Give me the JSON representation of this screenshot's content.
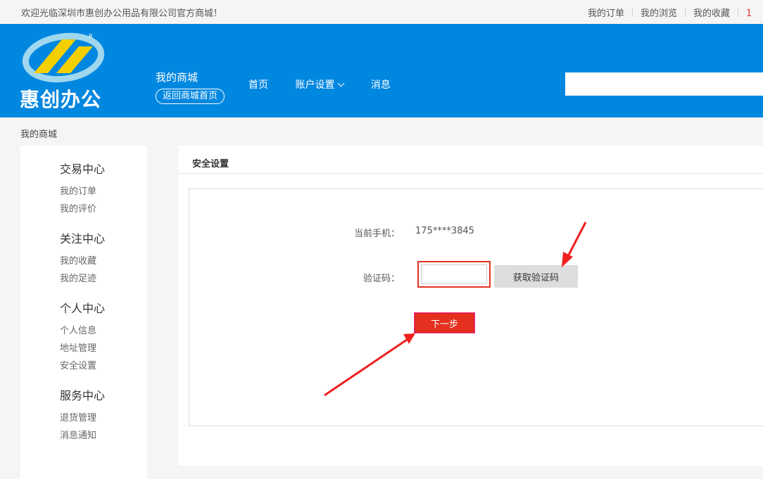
{
  "topbar": {
    "welcome": "欢迎光临深圳市惠创办公用品有限公司官方商城！",
    "links": [
      "我的订单",
      "我的浏览",
      "我的收藏"
    ],
    "cut_text": "1"
  },
  "header": {
    "logo_text": "惠创办公",
    "logo_mark": "R",
    "my_mall": "我的商城",
    "back_button": "返回商城首页",
    "nav": {
      "home": "首页",
      "account": "账户设置",
      "messages": "消息"
    },
    "search_placeholder": ""
  },
  "breadcrumb": "我的商城",
  "sidebar": {
    "groups": [
      {
        "title": "交易中心",
        "items": [
          "我的订单",
          "我的评价"
        ]
      },
      {
        "title": "关注中心",
        "items": [
          "我的收藏",
          "我的足迹"
        ]
      },
      {
        "title": "个人中心",
        "items": [
          "个人信息",
          "地址管理",
          "安全设置"
        ]
      },
      {
        "title": "服务中心",
        "items": [
          "退货管理",
          "消息通知"
        ]
      }
    ]
  },
  "main": {
    "title": "安全设置",
    "phone_label": "当前手机：",
    "phone_value": "175****3845",
    "code_label": "验证码：",
    "code_value": "",
    "get_code_button": "获取验证码",
    "next_button": "下一步"
  },
  "colors": {
    "header_bg": "#0087e0",
    "accent_red": "#e53020",
    "annotation_red": "#f02020"
  }
}
